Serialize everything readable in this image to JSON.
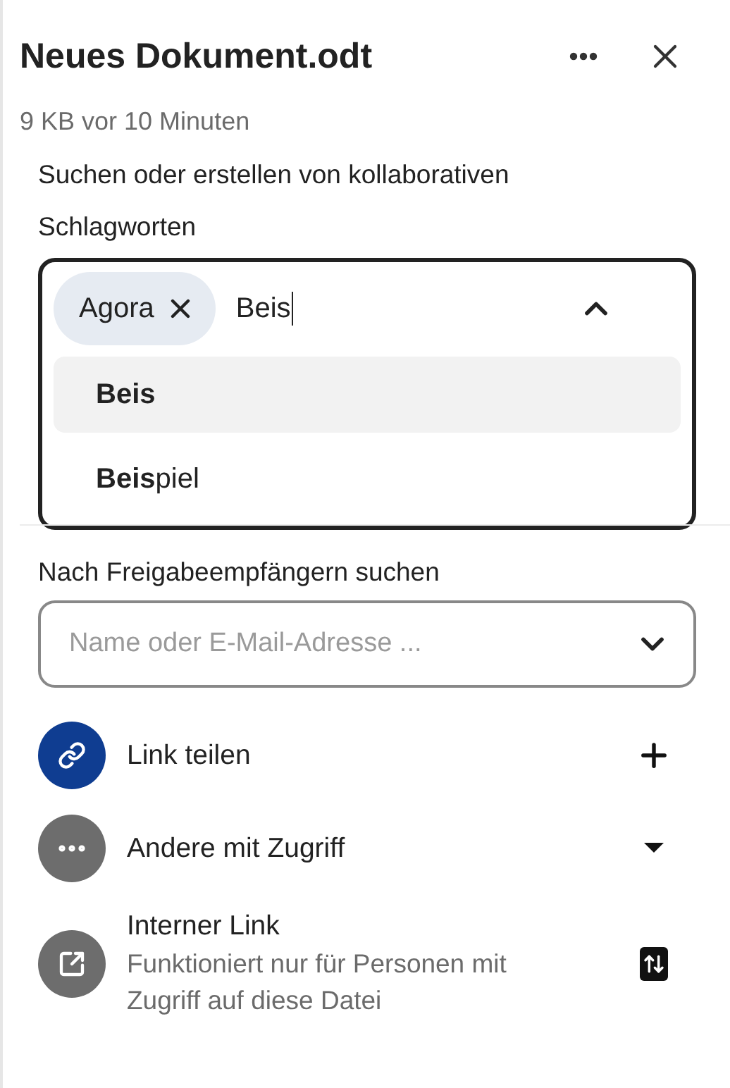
{
  "header": {
    "title": "Neues Dokument.odt",
    "meta": "9 KB vor 10 Minuten"
  },
  "tags": {
    "label": "Suchen oder erstellen von kollaborativen Schlagworten",
    "chips": [
      {
        "label": "Agora"
      }
    ],
    "query": "Beis",
    "expanded": true,
    "options": [
      {
        "label": "**Beis**",
        "selected": true
      },
      {
        "label": "**Beis**piel",
        "selected": false
      }
    ]
  },
  "share": {
    "label": "Nach Freigabeempfängern suchen",
    "placeholder": "Name oder E-Mail-Adresse ..."
  },
  "entries": [
    {
      "kind": "share-link",
      "title": "Link teilen"
    },
    {
      "kind": "others",
      "title": "Andere mit Zugriff"
    },
    {
      "kind": "internal",
      "title": "Interner Link",
      "description": "Funktioniert nur für Personen mit Zugriff auf diese Datei"
    }
  ]
}
